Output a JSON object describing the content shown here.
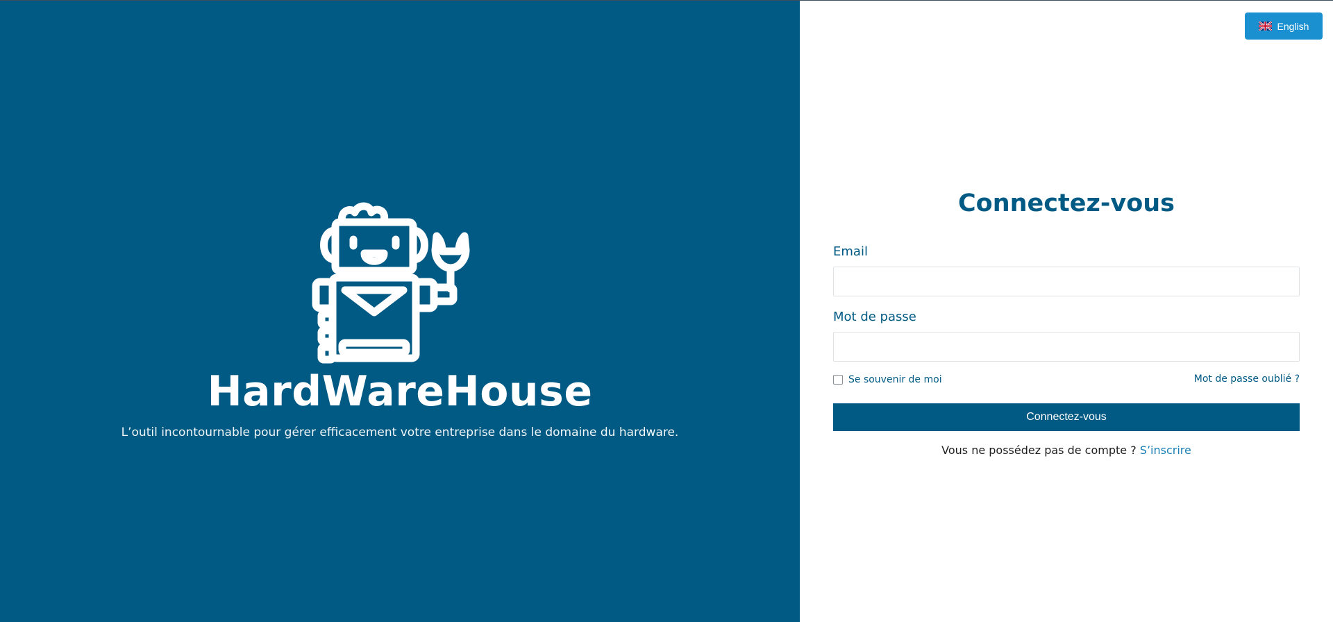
{
  "brand": {
    "name": "HardWareHouse",
    "tagline": "L’outil incontournable pour gérer efficacement votre entreprise dans le domaine du hardware.",
    "logo_icon": "robot-with-wrench-icon",
    "panel_color": "#005a84"
  },
  "language": {
    "label": "English",
    "flag_icon": "uk-flag-icon",
    "button_color": "#1a90d0"
  },
  "login": {
    "title": "Connectez-vous",
    "email_label": "Email",
    "email_value": "",
    "password_label": "Mot de passe",
    "password_value": "",
    "remember_label": "Se souvenir de moi",
    "remember_checked": false,
    "forgot_label": "Mot de passe oublié ?",
    "submit_label": "Connectez-vous",
    "signup_prompt": "Vous ne possédez pas de compte ? ",
    "signup_link": "S’inscrire"
  }
}
